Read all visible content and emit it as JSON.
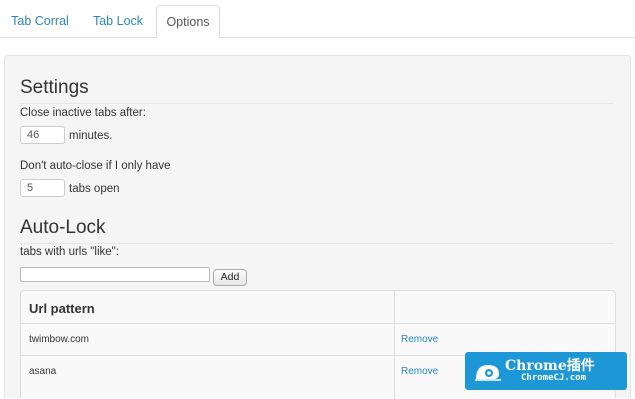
{
  "tabs": [
    {
      "label": "Tab Corral",
      "active": false
    },
    {
      "label": "Tab Lock",
      "active": false
    },
    {
      "label": "Options",
      "active": true
    }
  ],
  "settings": {
    "heading": "Settings",
    "close_inactive_label": "Close inactive tabs after:",
    "close_inactive_value": "46",
    "close_inactive_suffix": "minutes.",
    "min_tabs_label": "Don't auto-close if I only have",
    "min_tabs_value": "5",
    "min_tabs_suffix": "tabs open"
  },
  "autolock": {
    "heading": "Auto-Lock",
    "urls_label": "tabs with urls \"like\":",
    "url_input_value": "",
    "add_label": "Add",
    "table": {
      "header": "Url pattern",
      "rows": [
        {
          "pattern": "twimbow.com",
          "action": "Remove"
        },
        {
          "pattern": "asana",
          "action": "Remove"
        }
      ]
    }
  },
  "watermark": {
    "title": "Chrome插件",
    "subtitle": "ChromeCJ.com",
    "color": "#1e97d6"
  }
}
